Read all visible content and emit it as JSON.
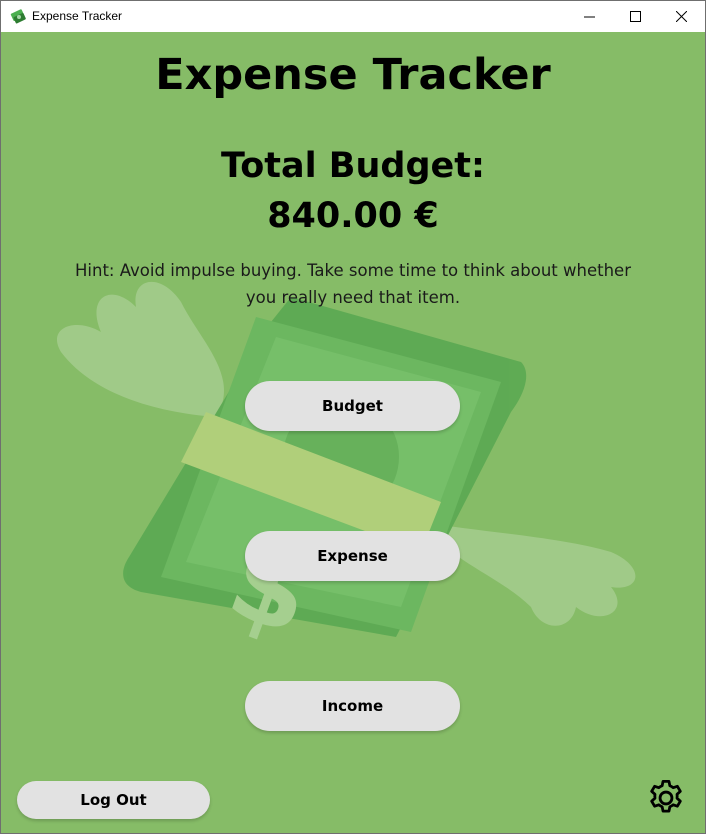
{
  "window": {
    "title": "Expense Tracker",
    "controls": [
      "minimize",
      "maximize",
      "close"
    ]
  },
  "main": {
    "title": "Expense Tracker",
    "budget_label": "Total Budget:",
    "budget_value": "840.00 €",
    "hint": "Hint: Avoid impulse buying. Take some time to think about whether you really need that item."
  },
  "buttons": {
    "budget": "Budget",
    "expense": "Expense",
    "income": "Income",
    "logout": "Log Out"
  },
  "icons": {
    "app": "money-icon",
    "settings": "gear-icon",
    "background": "flying-money-illustration"
  },
  "colors": {
    "background": "#86bc67",
    "button": "#e2e2e2",
    "text": "#000000"
  }
}
